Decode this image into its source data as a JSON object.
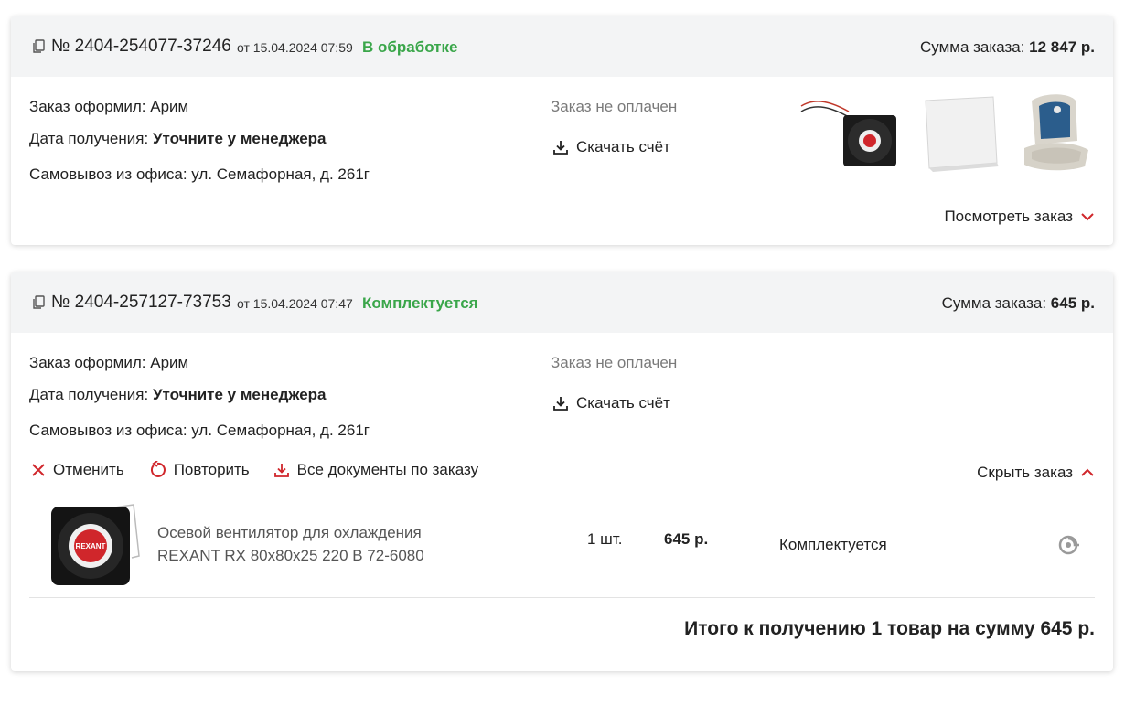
{
  "orders": [
    {
      "number": "№ 2404-254077-37246",
      "date_prefix": "от 15.04.2024 07:59",
      "status": "В обработке",
      "sum_label": "Сумма заказа:",
      "sum_value": "12 847 р.",
      "placed_by_label": "Заказ оформил:",
      "placed_by_value": "Арим",
      "receive_date_label": "Дата получения:",
      "receive_date_value": "Уточните у менеджера",
      "pickup": "Самовывоз из офиса: ул. Семафорная, д. 261г",
      "payment_status": "Заказ не оплачен",
      "download_label": "Скачать счёт",
      "toggle_label": "Посмотреть заказ",
      "thumbnails": [
        "fan-thumbnail",
        "panel-thumbnail",
        "boat-seat-thumbnail"
      ]
    },
    {
      "number": "№ 2404-257127-73753",
      "date_prefix": "от 15.04.2024 07:47",
      "status": "Комплектуется",
      "sum_label": "Сумма заказа:",
      "sum_value": "645 р.",
      "placed_by_label": "Заказ оформил:",
      "placed_by_value": "Арим",
      "receive_date_label": "Дата получения:",
      "receive_date_value": "Уточните у менеджера",
      "pickup": "Самовывоз из офиса: ул. Семафорная, д. 261г",
      "payment_status": "Заказ не оплачен",
      "download_label": "Скачать счёт",
      "toggle_label": "Скрыть заказ",
      "actions": {
        "cancel": "Отменить",
        "repeat": "Повторить",
        "documents": "Все документы по заказу"
      },
      "items": [
        {
          "name_line1": "Осевой вентилятор для охлаждения",
          "name_line2": "REXANT RX 80x80x25 220 В 72-6080",
          "qty": "1 шт.",
          "price": "645 р.",
          "status": "Комплектуется",
          "brand_text": "REXANT"
        }
      ],
      "total": "Итого к получению 1 товар на сумму 645 р."
    }
  ],
  "colors": {
    "status_green": "#3aa64a",
    "accent_red": "#d0262b",
    "header_bg": "#f3f4f5",
    "muted_text": "#7a7a7a"
  }
}
